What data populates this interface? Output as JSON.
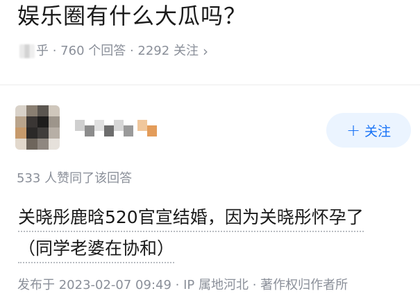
{
  "question": {
    "title": "娱乐圈有什么大瓜吗？",
    "meta_suffix": "乎 · 760 个回答 · 2292 关注",
    "chevron": "›"
  },
  "author": {
    "follow_label": "关注"
  },
  "answer": {
    "like_summary": "533 人赞同了该回答",
    "text_line1": "关晓彤鹿晗520官宣结婚，因为关晓彤怀孕了",
    "text_line2": "（同学老婆在协和）",
    "footer": "发布于 2023-02-07 09:49 · IP 属地河北 · 著作权归作者所"
  },
  "colors": {
    "accent": "#1772f6",
    "follow_bg": "#ebf4ff",
    "muted_text": "#8a8f99"
  },
  "icons": {
    "plus": "plus-icon",
    "chevron": "chevron-right-icon"
  }
}
